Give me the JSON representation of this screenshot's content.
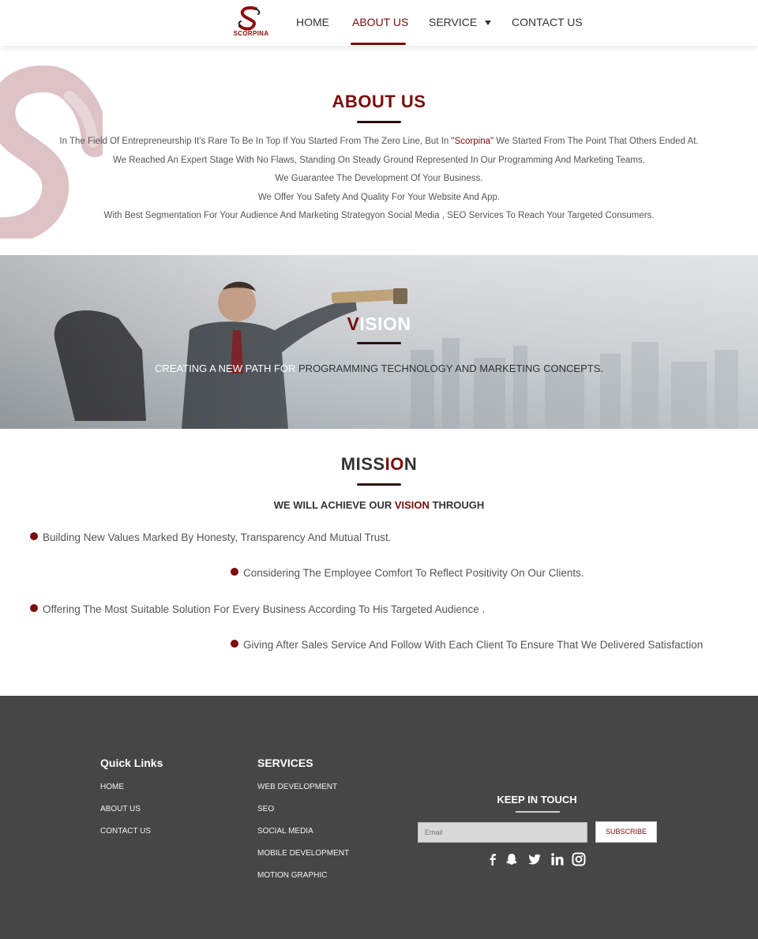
{
  "nav": {
    "logo_text": "SCORPINA",
    "items": [
      {
        "label": "HOME"
      },
      {
        "label": "ABOUT US"
      },
      {
        "label": "SERVICE"
      },
      {
        "label": "CONTACT US"
      }
    ]
  },
  "about": {
    "title": "ABOUT US",
    "line1_pre": "In The Field Of Entrepreneurship It's Rare To Be In Top If You Started From The Zero Line, But In ",
    "line1_brand": "\"Scorpina\"",
    "line1_post": " We Started From The Point That Others Ended At.",
    "line2": "We Reached An Expert Stage With No Flaws, Standing On Steady Ground Represented In Our Programming And Marketing Teams.",
    "line3": "We Guarantee The Development Of Your Business.",
    "line4": "We Offer You Safety And Quality For Your Website And App.",
    "line5": "With Best Segmentation  For Your Audience And Marketing Strategyon Social Media , SEO Services To Reach Your Targeted Consumers."
  },
  "vision": {
    "title_first": "V",
    "title_rest": "ISION",
    "text_white": "CREATING A NEW PATH FOR ",
    "text_dark": "PROGRAMMING TECHNOLOGY  AND MARKETING CONCEPTS."
  },
  "mission": {
    "title_a": "MISS",
    "title_b": "IO",
    "title_c": "N",
    "sub_pre": "WE WILL ACHIEVE OUR ",
    "sub_hl": "VISION",
    "sub_post": " THROUGH",
    "bullets": [
      "Building New Values Marked By Honesty, Transparency And Mutual Trust.",
      "Considering The Employee Comfort To Reflect Positivity On Our Clients.",
      "Offering The Most Suitable Solution For Every Business According To His Targeted Audience .",
      "Giving After Sales Service And Follow With Each Client To Ensure That We Delivered  Satisfaction"
    ]
  },
  "footer": {
    "quick_links_title": "Quick Links",
    "quick_links": [
      "HOME",
      "ABOUT US",
      "CONTACT US"
    ],
    "services_title": "SERVICES",
    "services": [
      "WEB DEVELOPMENT",
      "SEO",
      "SOCIAL MEDIA",
      "MOBILE DEVELOPMENT",
      "MOTION GRAPHIC"
    ],
    "keep_title": "KEEP IN TOUCH",
    "email_placeholder": "Email",
    "subscribe_label": "SUBSCRIBE",
    "social_icons": [
      "facebook-icon",
      "snapchat-icon",
      "twitter-icon",
      "linkedin-icon",
      "instagram-icon"
    ]
  },
  "colors": {
    "accent": "#7a0b0b",
    "footer_bg": "#464646"
  }
}
